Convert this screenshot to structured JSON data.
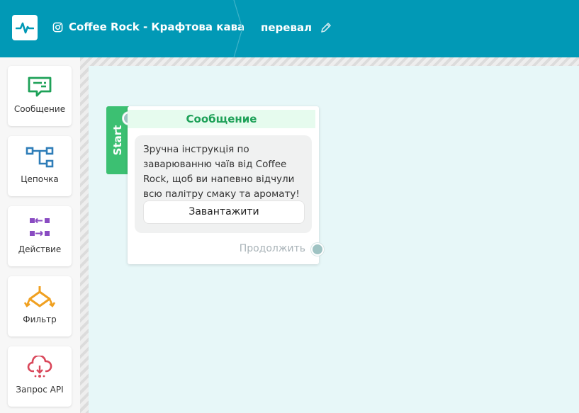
{
  "header": {
    "account_name": "Coffee Rock - Крафтова кава",
    "account_icon": "instagram-icon",
    "flow_name": "перевал",
    "edit_icon": "pencil-icon",
    "background": "#0199b6"
  },
  "sidebar": {
    "items": [
      {
        "label": "Сообщение",
        "icon": "message-icon",
        "color": "#1ea158"
      },
      {
        "label": "Цепочка",
        "icon": "chain-icon",
        "color": "#2e7db8"
      },
      {
        "label": "Действие",
        "icon": "action-icon",
        "color": "#8a4cc2"
      },
      {
        "label": "Фильтр",
        "icon": "filter-icon",
        "color": "#f0a020"
      },
      {
        "label": "Запрос API",
        "icon": "api-request-icon",
        "color": "#d9475a"
      }
    ]
  },
  "node": {
    "start_label": "Start",
    "title": "Сообщение",
    "message_text": "Зручна інструкція по заварюванню чаїв від Coffee Rock, щоб ви напевно відчули всю палітру смаку та аромату!",
    "button_label": "Завантажити",
    "continue_label": "Продолжить",
    "accent": "#3cc072"
  }
}
